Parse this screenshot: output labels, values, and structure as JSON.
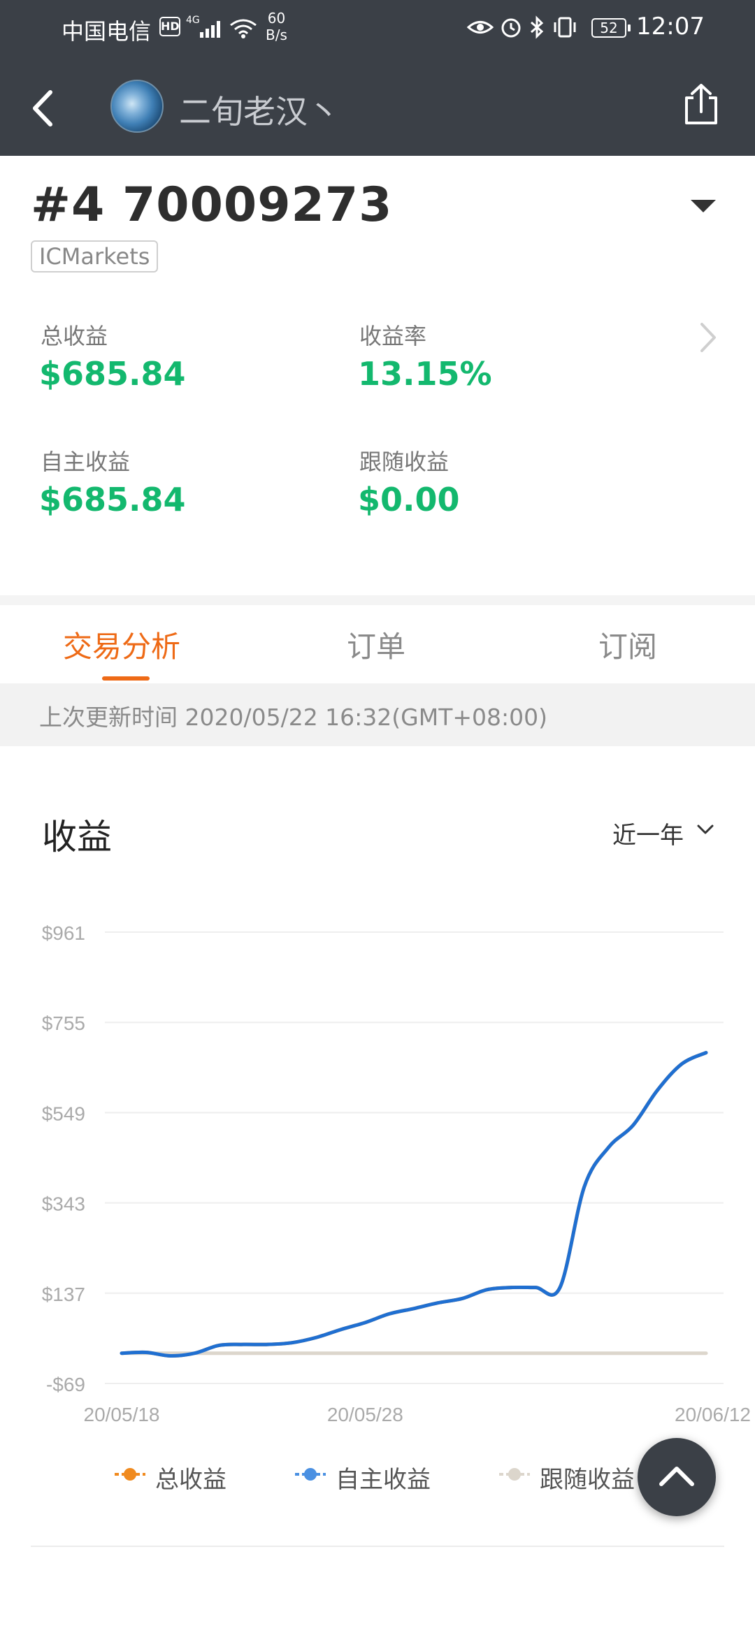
{
  "status_bar": {
    "carrier": "中国电信",
    "hd": "HD",
    "network": "4G",
    "speed_value": "60",
    "speed_unit": "B/s",
    "battery": "52",
    "time": "12:07"
  },
  "header": {
    "username": "二旬老汉丶"
  },
  "account": {
    "title": "#4 70009273",
    "broker": "ICMarkets"
  },
  "stats": {
    "total_label": "总收益",
    "total_value": "$685.84",
    "rate_label": "收益率",
    "rate_value": "13.15%",
    "self_label": "自主收益",
    "self_value": "$685.84",
    "follow_label": "跟随收益",
    "follow_value": "$0.00"
  },
  "tabs": [
    {
      "label": "交易分析",
      "active": true
    },
    {
      "label": "订单",
      "active": false
    },
    {
      "label": "订阅",
      "active": false
    }
  ],
  "update_text": "上次更新时间 2020/05/22 16:32(GMT+08:00)",
  "section": {
    "title": "收益",
    "range": "近一年"
  },
  "colors": {
    "header_bg": "#3b4047",
    "accent": "#ee6a16",
    "positive": "#13b86e",
    "series_self": "#1f6fd1",
    "series_total": "#f08a1e",
    "series_follow": "#dcd6cc"
  },
  "chart_data": {
    "type": "line",
    "y_ticks": [
      "$961",
      "$755",
      "$549",
      "$343",
      "$137",
      "-$69"
    ],
    "ylim": [
      -69,
      961
    ],
    "x_ticks": [
      "20/05/18",
      "20/05/28",
      "20/06/12"
    ],
    "x_tick_index": [
      0,
      10,
      25
    ],
    "grid": true,
    "legend_position": "bottom",
    "series": [
      {
        "name": "总收益",
        "color": "#f08a1e",
        "values": [
          0,
          2,
          -6,
          0,
          18,
          20,
          20,
          24,
          36,
          54,
          70,
          90,
          102,
          115,
          125,
          145,
          150,
          150,
          150,
          380,
          470,
          520,
          600,
          660,
          685.84
        ]
      },
      {
        "name": "自主收益",
        "color": "#1f6fd1",
        "values": [
          0,
          2,
          -6,
          0,
          18,
          20,
          20,
          24,
          36,
          54,
          70,
          90,
          102,
          115,
          125,
          145,
          150,
          150,
          150,
          380,
          470,
          520,
          600,
          660,
          685.84
        ]
      },
      {
        "name": "跟随收益",
        "color": "#dcd6cc",
        "values": [
          0,
          0,
          0,
          0,
          0,
          0,
          0,
          0,
          0,
          0,
          0,
          0,
          0,
          0,
          0,
          0,
          0,
          0,
          0,
          0,
          0,
          0,
          0,
          0,
          0
        ]
      }
    ]
  }
}
